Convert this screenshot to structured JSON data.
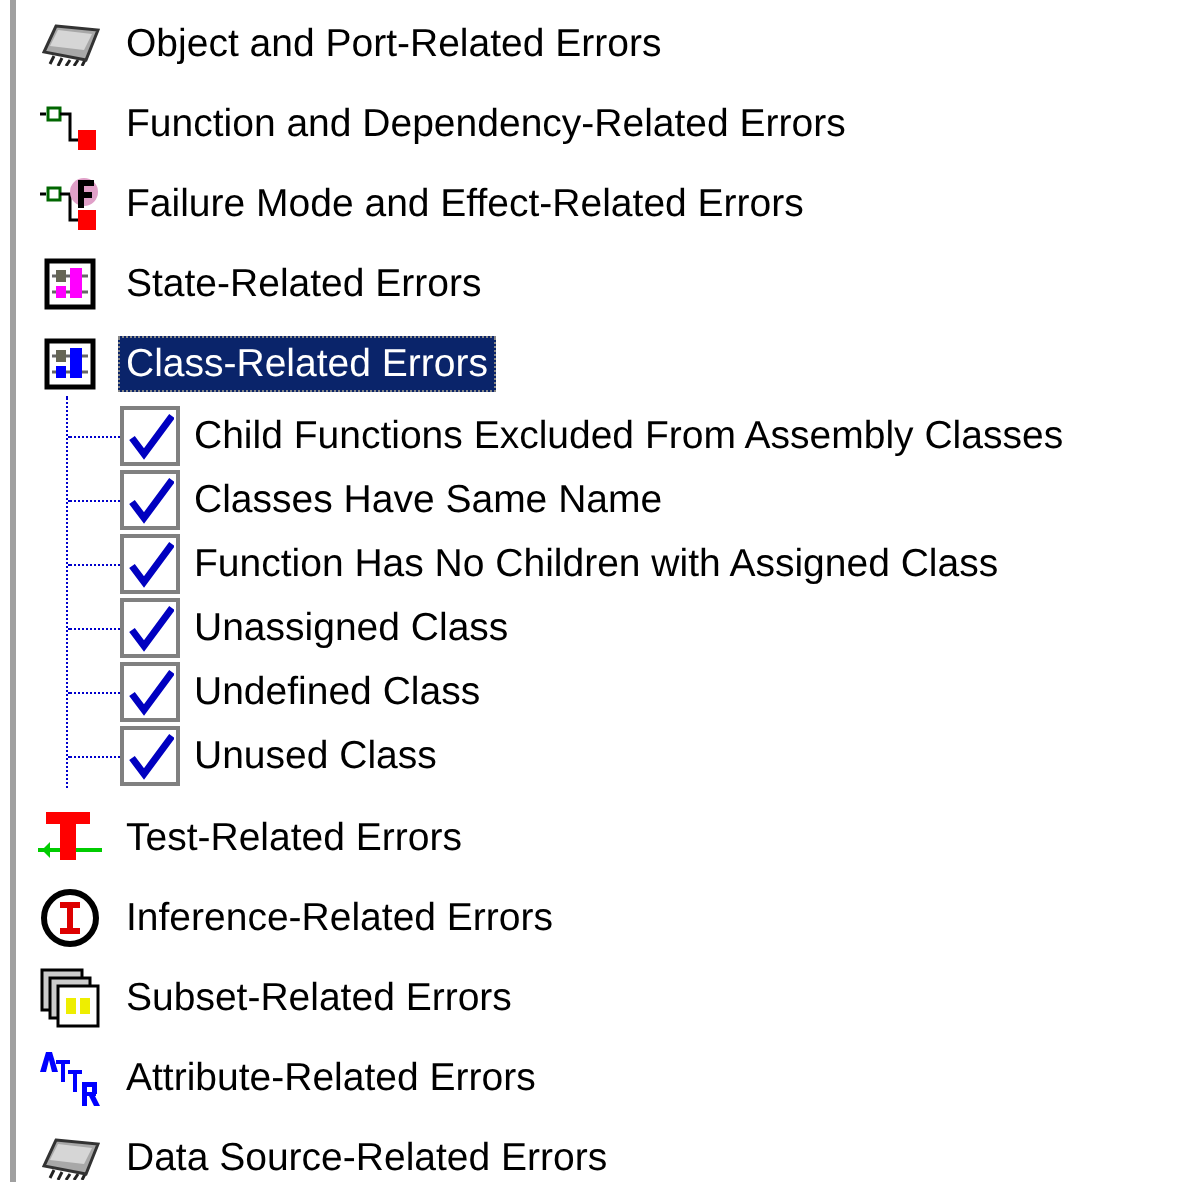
{
  "tree": [
    {
      "kind": "chip",
      "label": "Object and Port-Related Errors",
      "selected": false
    },
    {
      "kind": "function",
      "label": "Function and Dependency-Related Errors",
      "selected": false
    },
    {
      "kind": "fmea",
      "label": "Failure Mode and Effect-Related Errors",
      "selected": false
    },
    {
      "kind": "state",
      "label": "State-Related Errors",
      "selected": false
    },
    {
      "kind": "class",
      "label": "Class-Related Errors",
      "selected": true,
      "expanded": true,
      "children": [
        {
          "label": "Child Functions Excluded From Assembly Classes",
          "checked": true
        },
        {
          "label": "Classes Have Same Name",
          "checked": true
        },
        {
          "label": "Function Has No Children with Assigned Class",
          "checked": true
        },
        {
          "label": "Unassigned Class",
          "checked": true
        },
        {
          "label": "Undefined Class",
          "checked": true
        },
        {
          "label": "Unused Class",
          "checked": true
        }
      ]
    },
    {
      "kind": "test",
      "label": "Test-Related Errors",
      "selected": false
    },
    {
      "kind": "inference",
      "label": "Inference-Related Errors",
      "selected": false
    },
    {
      "kind": "subset",
      "label": "Subset-Related Errors",
      "selected": false
    },
    {
      "kind": "attribute",
      "label": "Attribute-Related Errors",
      "selected": false
    },
    {
      "kind": "chip",
      "label": "Data Source-Related Errors",
      "selected": false
    }
  ]
}
